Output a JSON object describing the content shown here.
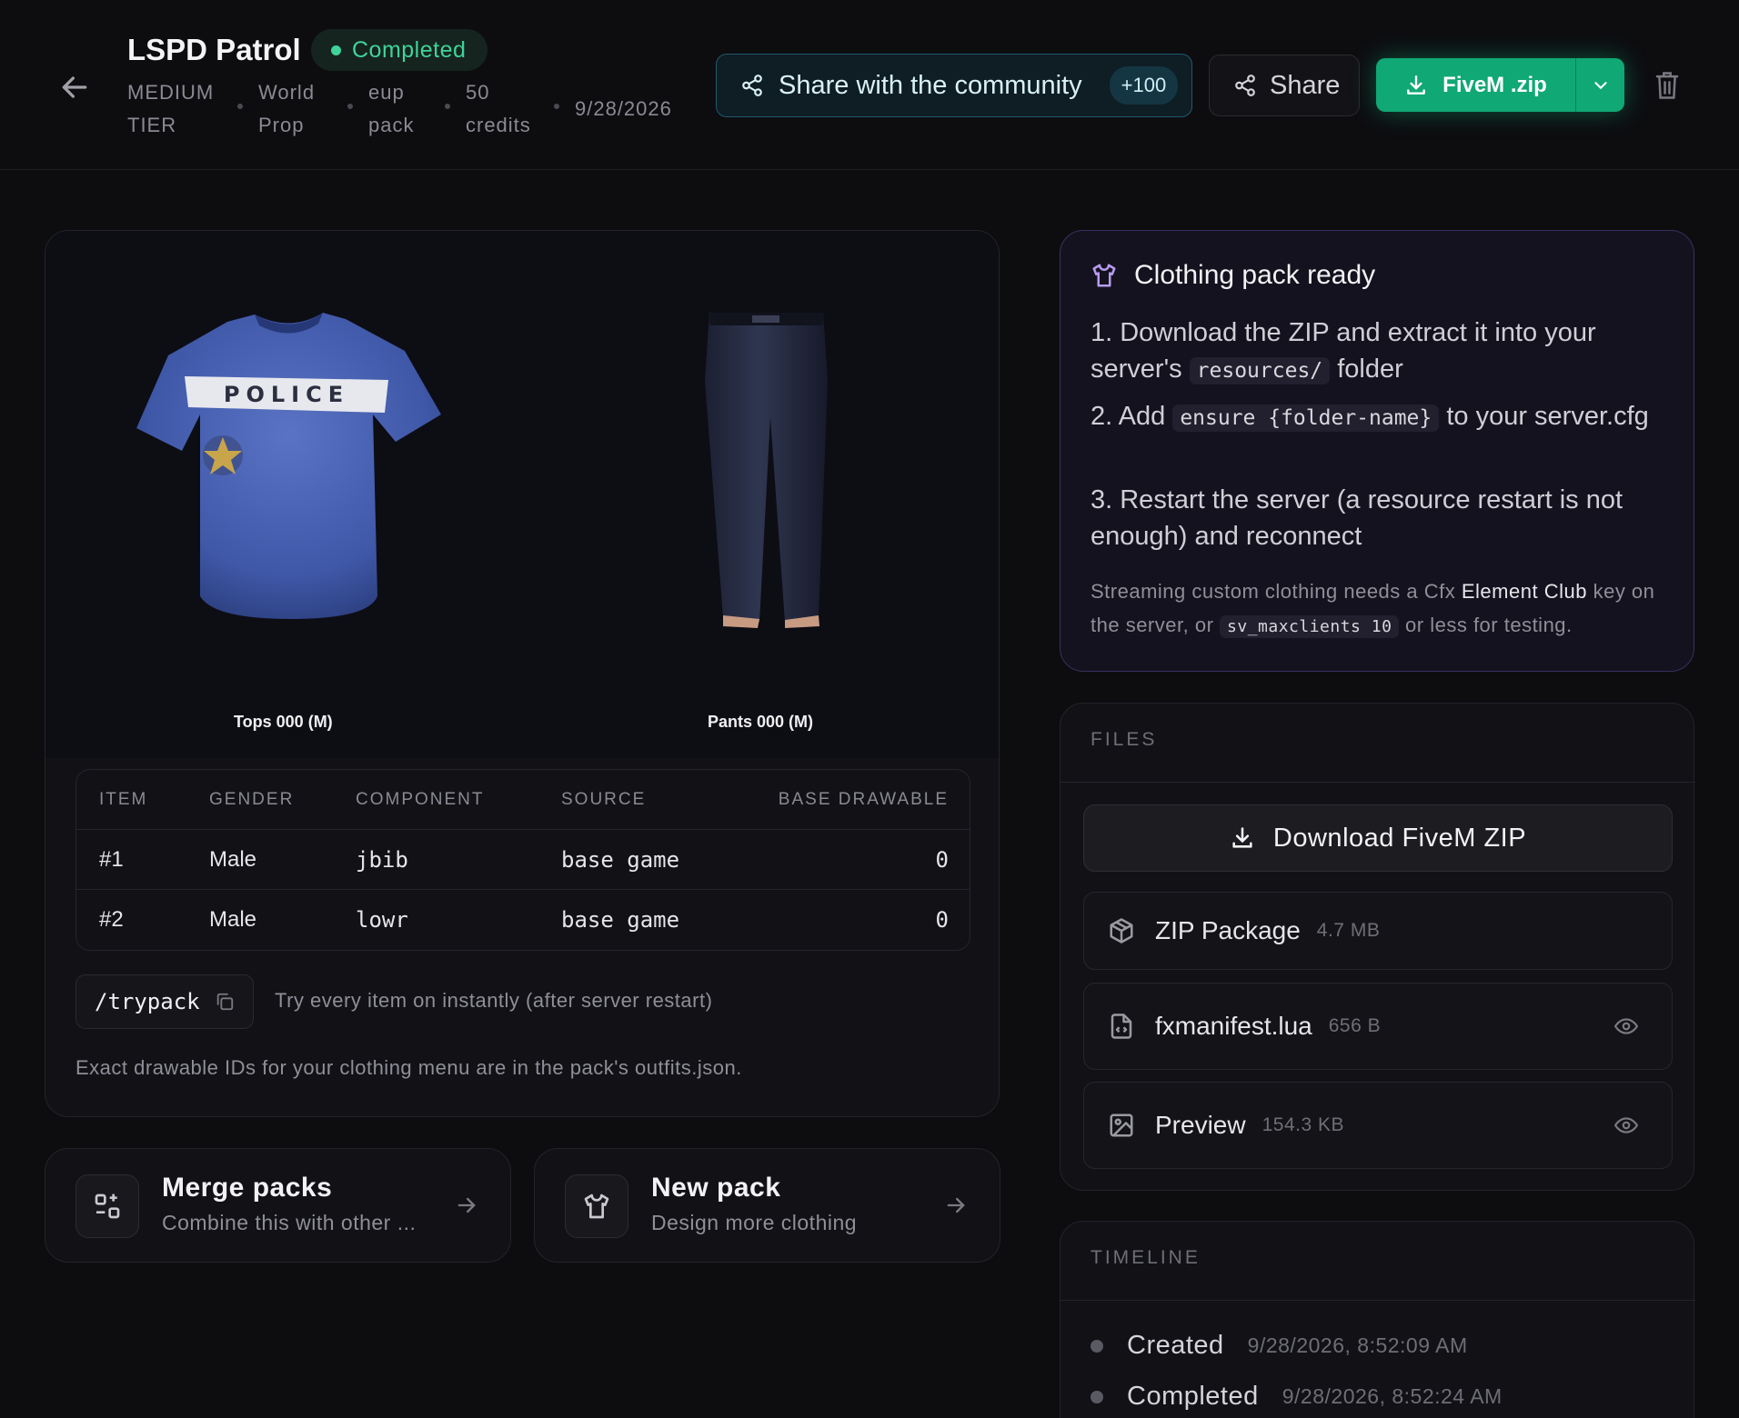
{
  "header": {
    "title": "LSPD Patrol",
    "status": "Completed",
    "meta": [
      {
        "line1": "MEDIUM",
        "line2": "TIER"
      },
      {
        "line1": "World",
        "line2": "Prop"
      },
      {
        "line1": "eup",
        "line2": "pack"
      },
      {
        "line1": "50",
        "line2": "credits"
      }
    ],
    "date": "9/28/2026",
    "share_community_label": "Share with the community",
    "share_community_points": "+100",
    "share_label": "Share",
    "download_label": "FiveM .zip"
  },
  "preview": {
    "items": [
      {
        "caption": "Tops 000 (M)",
        "shirt_text": "POLICE"
      },
      {
        "caption": "Pants 000 (M)"
      }
    ]
  },
  "table": {
    "headers": [
      "ITEM",
      "GENDER",
      "COMPONENT",
      "SOURCE",
      "BASE DRAWABLE"
    ],
    "rows": [
      [
        "#1",
        "Male",
        "jbib",
        "base game",
        "0"
      ],
      [
        "#2",
        "Male",
        "lowr",
        "base game",
        "0"
      ]
    ]
  },
  "trypack": {
    "command": "/trypack",
    "hint": "Try every item on instantly (after server restart)",
    "note": "Exact drawable IDs for your clothing menu are in the pack's outfits.json."
  },
  "actions": [
    {
      "title": "Merge packs",
      "subtitle": "Combine this with other ..."
    },
    {
      "title": "New pack",
      "subtitle": "Design more clothing"
    }
  ],
  "ready": {
    "title": "Clothing pack ready",
    "step1_a": "1. Download the ZIP and extract it into your server's",
    "step1_code": "resources/",
    "step1_b": "folder",
    "step2_a": "2. Add",
    "step2_code": "ensure {folder-name}",
    "step2_b": "to your server.cfg",
    "step3": "3. Restart the server (a resource restart is not enough) and reconnect",
    "note_a": "Streaming custom clothing needs a Cfx",
    "note_b": "Element Club",
    "note_c": "key on the server, or",
    "note_code": "sv_maxclients 10",
    "note_d": "or less for testing."
  },
  "files": {
    "section_title": "FILES",
    "download_label": "Download FiveM ZIP",
    "items": [
      {
        "name": "ZIP Package",
        "size": "4.7 MB",
        "icon": "package-icon"
      },
      {
        "name": "fxmanifest.lua",
        "size": "656 B",
        "icon": "code-file-icon"
      },
      {
        "name": "Preview",
        "size": "154.3 KB",
        "icon": "image-icon"
      }
    ]
  },
  "timeline": {
    "section_title": "TIMELINE",
    "items": [
      {
        "label": "Created",
        "value": "9/28/2026, 8:52:09 AM"
      },
      {
        "label": "Completed",
        "value": "9/28/2026, 8:52:24 AM"
      }
    ]
  },
  "colors": {
    "accent": "#10a874",
    "status": "#3fd39a",
    "community": "#1f5a6d",
    "ready_border": "#3b2f5e"
  }
}
